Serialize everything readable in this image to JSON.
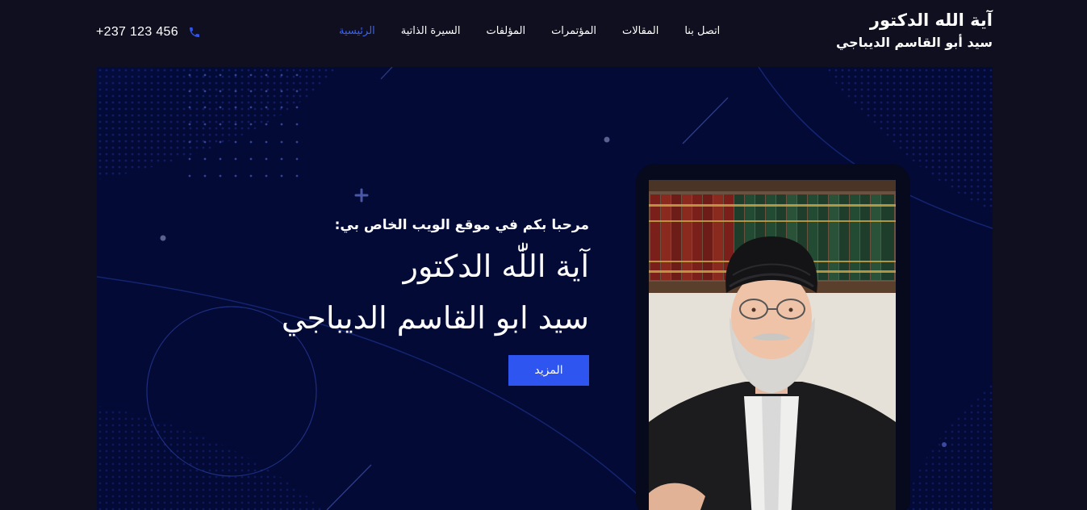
{
  "header": {
    "logo_line1": "آية الله الدكتور",
    "logo_line2": "سيد أبو القاسم الديباجي",
    "phone": "+237 123 456",
    "nav": [
      {
        "label": "الرئيسية",
        "active": true
      },
      {
        "label": "السيرة الذاتية",
        "active": false
      },
      {
        "label": "المؤلفات",
        "active": false
      },
      {
        "label": "المؤتمرات",
        "active": false
      },
      {
        "label": "المقالات",
        "active": false
      },
      {
        "label": "اتصل بنا",
        "active": false
      }
    ]
  },
  "hero": {
    "welcome": "مرحبا بكم في موقع الويب الخاص بي:",
    "title1": "آية اللّٰه الدكتور",
    "title2": "سيد ابو القاسم الديباجي",
    "button": "المزيد"
  },
  "colors": {
    "accent": "#2e55f0",
    "active_nav": "#3d62ea",
    "header_bg": "#0f0f1f",
    "hero_bg": "#020a35"
  },
  "icons": {
    "phone": "phone-icon"
  }
}
